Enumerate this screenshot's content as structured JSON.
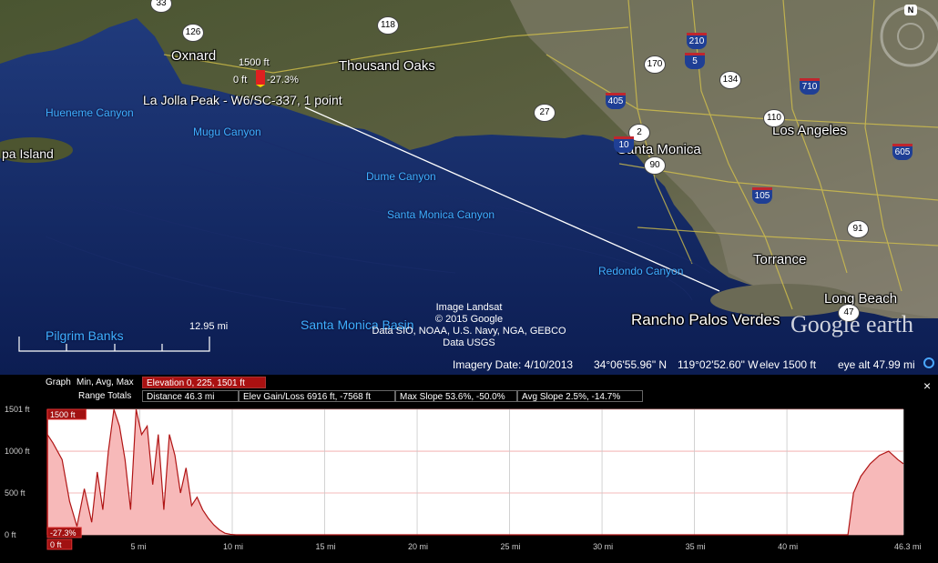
{
  "map": {
    "places": {
      "oxnard": "Oxnard",
      "thousand_oaks": "Thousand Oaks",
      "santa_monica": "Santa Monica",
      "los_angeles": "Los Angeles",
      "torrance": "Torrance",
      "long_beach": "Long Beach",
      "rancho": "Rancho Palos Verdes",
      "island": "pa Island"
    },
    "canyons": {
      "hueneme": "Hueneme Canyon",
      "mugu": "Mugu Canyon",
      "dume": "Dume Canyon",
      "santa_monica": "Santa Monica Canyon",
      "redondo": "Redondo Canyon",
      "pilgrim": "Pilgrim Banks",
      "basin": "Santa Monica Basin"
    },
    "shields": {
      "s33": "33",
      "s126": "126",
      "s118": "118",
      "s170": "170",
      "s134": "134",
      "s27": "27",
      "s2": "2",
      "s90": "90",
      "s110": "110",
      "s91": "91",
      "s47": "47",
      "i210": "210",
      "i5": "5",
      "i405": "405",
      "i710": "710",
      "i605": "605",
      "i105": "105",
      "i10": "10"
    },
    "marker": {
      "title": "La Jolla Peak - W6/SC-337, 1 point",
      "elev": "1500 ft",
      "zero": "0 ft",
      "slope": "-27.3%"
    },
    "credits": [
      "Image Landsat",
      "© 2015 Google",
      "Data SIO, NOAA, U.S. Navy, NGA, GEBCO",
      "Data USGS"
    ],
    "scale_label": "12.95 mi",
    "logo": "Google earth",
    "compass": "N",
    "status": {
      "imagery_date": "Imagery Date: 4/10/2013",
      "lat": "34°06'55.96\" N",
      "lon": "119°02'52.60\" W",
      "elev": "elev  1500 ft",
      "eye_alt": "eye alt  47.99 mi"
    }
  },
  "profile": {
    "graph_label": "Graph",
    "graph_opts": "Min, Avg, Max",
    "elevation": "Elevation  0, 225, 1501 ft",
    "range_totals": "Range Totals",
    "distance": "Distance  46.3 mi",
    "gain_loss": "Elev Gain/Loss  6916 ft, -7568 ft",
    "max_slope": "Max Slope  53.6%, -50.0%",
    "avg_slope": "Avg Slope  2.5%, -14.7%",
    "close": "×",
    "cursor_elev": "1500 ft",
    "cursor_slope": "-27.3%",
    "cursor_x": "0 ft",
    "y_ticks": [
      "1501 ft",
      "1000 ft",
      "500 ft",
      "0 ft"
    ],
    "x_ticks": [
      "5 mi",
      "10 mi",
      "15 mi",
      "20 mi",
      "25 mi",
      "30 mi",
      "35 mi",
      "40 mi",
      "46.3 mi"
    ],
    "colors": {
      "fill": "#f7b9b9",
      "line": "#b01515",
      "grid": "#c8c8c8"
    }
  },
  "chart_data": {
    "type": "area",
    "xlabel": "",
    "ylabel": "",
    "xlim": [
      0,
      46.3
    ],
    "ylim": [
      0,
      1501
    ],
    "x": [
      0,
      0.3,
      0.8,
      1.2,
      1.6,
      2.0,
      2.4,
      2.7,
      3.0,
      3.3,
      3.6,
      3.9,
      4.2,
      4.5,
      4.8,
      5.1,
      5.4,
      5.7,
      6.0,
      6.3,
      6.6,
      6.9,
      7.2,
      7.5,
      7.8,
      8.1,
      8.4,
      8.7,
      9.0,
      9.3,
      9.6,
      9.9,
      10.2,
      11,
      20,
      30,
      40,
      43.3,
      43.6,
      44.0,
      44.5,
      45.0,
      45.5,
      46.0,
      46.3
    ],
    "y": [
      1200,
      1100,
      900,
      400,
      100,
      550,
      150,
      750,
      300,
      1000,
      1500,
      1300,
      900,
      300,
      1500,
      1200,
      1300,
      600,
      1200,
      300,
      1200,
      950,
      500,
      800,
      350,
      450,
      300,
      200,
      120,
      60,
      20,
      5,
      0,
      0,
      0,
      0,
      0,
      0,
      500,
      700,
      850,
      950,
      1000,
      900,
      850
    ]
  }
}
